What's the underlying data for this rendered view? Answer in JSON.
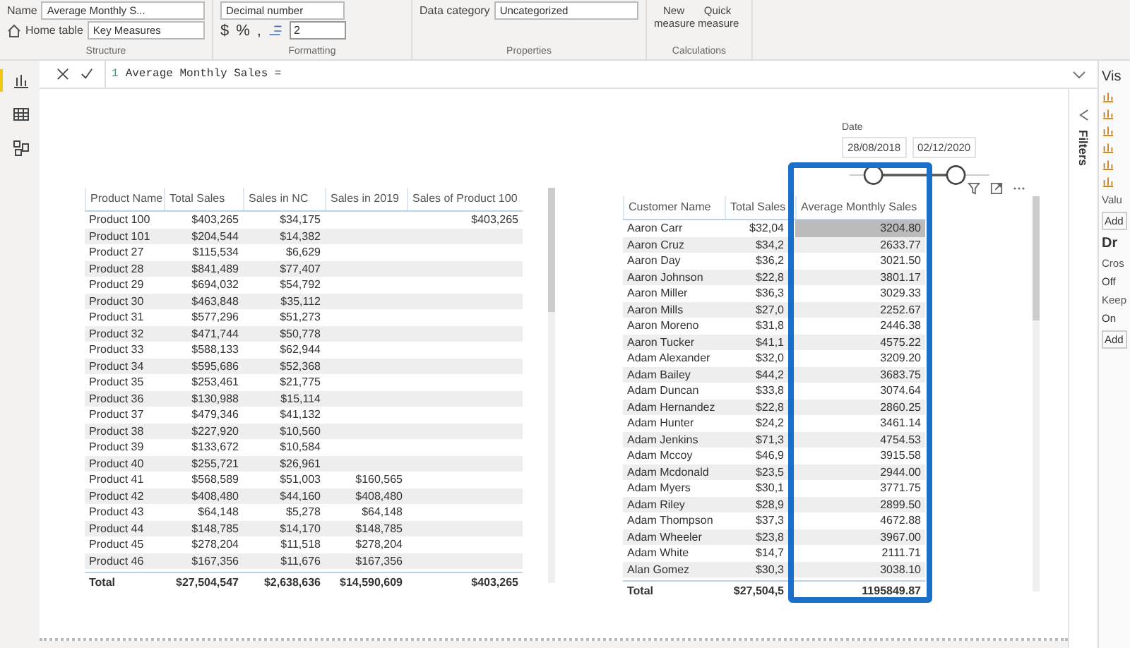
{
  "ribbon": {
    "groups": [
      {
        "kind": "structure",
        "label": "Structure",
        "name_label": "Name",
        "name_value": "Average Monthly S...",
        "home_label": "Home table",
        "home_value": "Key Measures"
      },
      {
        "kind": "formatting",
        "label": "Formatting",
        "format_value": "Decimal number",
        "currency": "$",
        "percent": "%",
        "comma": ",",
        "decimals": "2"
      },
      {
        "kind": "properties",
        "label": "Properties",
        "category_label": "Data category",
        "category_value": "Uncategorized"
      },
      {
        "kind": "calculations",
        "label": "Calculations",
        "buttons": [
          "New measure",
          "Quick measure"
        ]
      }
    ]
  },
  "formula_bar": {
    "line_number": "1",
    "formula": "Average Monthly Sales ="
  },
  "nav": [
    {
      "kind": "report",
      "selected": true
    },
    {
      "kind": "data",
      "selected": false
    },
    {
      "kind": "model",
      "selected": false
    }
  ],
  "slicer": {
    "title": "Date",
    "start": "28/08/2018",
    "end": "02/12/2020",
    "handles": [
      {
        "level": 0.17
      },
      {
        "level": 0.76
      }
    ]
  },
  "product_table": {
    "columns": [
      "Product Name",
      "Total Sales",
      "Sales in NC",
      "Sales in 2019",
      "Sales of Product 100"
    ],
    "rows": [
      [
        "Product 100",
        "$403,265",
        "$34,175",
        "",
        "$403,265"
      ],
      [
        "Product 101",
        "$204,544",
        "$14,382",
        "",
        ""
      ],
      [
        "Product 27",
        "$115,534",
        "$6,629",
        "",
        ""
      ],
      [
        "Product 28",
        "$841,489",
        "$77,407",
        "",
        ""
      ],
      [
        "Product 29",
        "$694,032",
        "$54,792",
        "",
        ""
      ],
      [
        "Product 30",
        "$463,848",
        "$35,112",
        "",
        ""
      ],
      [
        "Product 31",
        "$577,296",
        "$51,273",
        "",
        ""
      ],
      [
        "Product 32",
        "$471,744",
        "$50,778",
        "",
        ""
      ],
      [
        "Product 33",
        "$588,133",
        "$62,944",
        "",
        ""
      ],
      [
        "Product 34",
        "$595,686",
        "$52,368",
        "",
        ""
      ],
      [
        "Product 35",
        "$253,461",
        "$21,775",
        "",
        ""
      ],
      [
        "Product 36",
        "$130,988",
        "$15,114",
        "",
        ""
      ],
      [
        "Product 37",
        "$479,346",
        "$41,132",
        "",
        ""
      ],
      [
        "Product 38",
        "$227,920",
        "$10,560",
        "",
        ""
      ],
      [
        "Product 39",
        "$133,672",
        "$10,584",
        "",
        ""
      ],
      [
        "Product 40",
        "$255,721",
        "$26,961",
        "",
        ""
      ],
      [
        "Product 41",
        "$568,589",
        "$51,003",
        "$160,565",
        ""
      ],
      [
        "Product 42",
        "$408,480",
        "$44,160",
        "$408,480",
        ""
      ],
      [
        "Product 43",
        "$64,148",
        "$5,278",
        "$64,148",
        ""
      ],
      [
        "Product 44",
        "$148,785",
        "$14,170",
        "$148,785",
        ""
      ],
      [
        "Product 45",
        "$278,204",
        "$11,518",
        "$278,204",
        ""
      ],
      [
        "Product 46",
        "$167,356",
        "$11,676",
        "$167,356",
        ""
      ]
    ],
    "total": [
      "Total",
      "$27,504,547",
      "$2,638,636",
      "$14,590,609",
      "$403,265"
    ]
  },
  "customer_table": {
    "columns": [
      "Customer Name",
      "Total Sales",
      "Average Monthly Sales"
    ],
    "rows": [
      {
        "cells": [
          "Aaron Carr",
          "$32,04",
          "3204.80"
        ],
        "selected": true
      },
      {
        "cells": [
          "Aaron Cruz",
          "$34,2",
          "2633.77"
        ],
        "selected": false
      },
      {
        "cells": [
          "Aaron Day",
          "$36,2",
          "3021.50"
        ],
        "selected": false
      },
      {
        "cells": [
          "Aaron Johnson",
          "$22,8",
          "3801.17"
        ],
        "selected": false
      },
      {
        "cells": [
          "Aaron Miller",
          "$36,3",
          "3029.33"
        ],
        "selected": false
      },
      {
        "cells": [
          "Aaron Mills",
          "$27,0",
          "2252.67"
        ],
        "selected": false
      },
      {
        "cells": [
          "Aaron Moreno",
          "$31,8",
          "2446.38"
        ],
        "selected": false
      },
      {
        "cells": [
          "Aaron Tucker",
          "$41,1",
          "4575.22"
        ],
        "selected": false
      },
      {
        "cells": [
          "Adam Alexander",
          "$32,0",
          "3209.20"
        ],
        "selected": false
      },
      {
        "cells": [
          "Adam Bailey",
          "$44,2",
          "3683.75"
        ],
        "selected": false
      },
      {
        "cells": [
          "Adam Duncan",
          "$33,8",
          "3074.64"
        ],
        "selected": false
      },
      {
        "cells": [
          "Adam Hernandez",
          "$22,8",
          "2860.25"
        ],
        "selected": false
      },
      {
        "cells": [
          "Adam Hunter",
          "$24,2",
          "3461.14"
        ],
        "selected": false
      },
      {
        "cells": [
          "Adam Jenkins",
          "$71,3",
          "4754.53"
        ],
        "selected": false
      },
      {
        "cells": [
          "Adam Mccoy",
          "$46,9",
          "3915.58"
        ],
        "selected": false
      },
      {
        "cells": [
          "Adam Mcdonald",
          "$23,5",
          "2944.00"
        ],
        "selected": false
      },
      {
        "cells": [
          "Adam Myers",
          "$30,1",
          "3771.75"
        ],
        "selected": false
      },
      {
        "cells": [
          "Adam Riley",
          "$28,9",
          "2899.50"
        ],
        "selected": false
      },
      {
        "cells": [
          "Adam Thompson",
          "$37,3",
          "4672.88"
        ],
        "selected": false
      },
      {
        "cells": [
          "Adam Wheeler",
          "$23,8",
          "3967.00"
        ],
        "selected": false
      },
      {
        "cells": [
          "Adam White",
          "$14,7",
          "2111.71"
        ],
        "selected": false
      },
      {
        "cells": [
          "Alan Gomez",
          "$30,3",
          "3038.10"
        ],
        "selected": false
      }
    ],
    "total": [
      "Total",
      "$27,504,5",
      "1195849.87"
    ],
    "highlighted_column": true
  },
  "filters_pane": {
    "title": "Filters"
  },
  "visualizations_pane": {
    "title": "Vis",
    "values_label": "Valu",
    "add_1": "Add",
    "drill_label": "Dr",
    "cross_label": "Cros",
    "cross_value": "Off",
    "keep_label": "Keep",
    "keep_value": "On",
    "add_2": "Add"
  }
}
